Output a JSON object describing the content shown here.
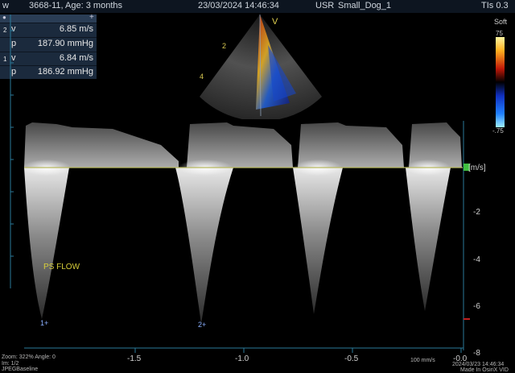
{
  "header": {
    "left_text": "3668-11, Age: 3 months",
    "left_prefix": "w",
    "datetime": "23/03/2024 14:46:34",
    "user": "USR",
    "patient": "Small_Dog_1",
    "tis": "TIs 0.3"
  },
  "measurements": {
    "items": [
      {
        "index": "2",
        "label": "v",
        "value": "6.85 m/s"
      },
      {
        "index": "",
        "label": "p",
        "value": "187.90 mmHg"
      },
      {
        "index": "1",
        "label": "v",
        "value": "6.84 m/s"
      },
      {
        "index": "",
        "label": "p",
        "value": "186.92 mmHg"
      }
    ]
  },
  "sector": {
    "label_v": "V",
    "label_2": "2",
    "label_4": "4"
  },
  "color_scale": {
    "mode": "Soft",
    "top": "75",
    "bottom": "-.75"
  },
  "doppler": {
    "annotation": "PS FLOW",
    "unit": "[m/s]",
    "y_ticks": [
      "-2",
      "-4",
      "-6",
      "-8"
    ],
    "x_ticks": [
      "-1.5",
      "-1.0",
      "-0.5",
      "-0.0"
    ],
    "markers": [
      "1",
      "2"
    ],
    "sweep_label": "100 mm/s"
  },
  "footer": {
    "zoom": "Zoom: 322% Angle: 0",
    "im": "Im: 1/2",
    "codec": "JPEGBaseline",
    "stamp": "2024/03/23 14:46:34",
    "made": "Made In OsiriX VID"
  },
  "colors": {
    "accent": "#c8c040",
    "panel": "#1b2a3d",
    "baseline": "#b7b860"
  }
}
